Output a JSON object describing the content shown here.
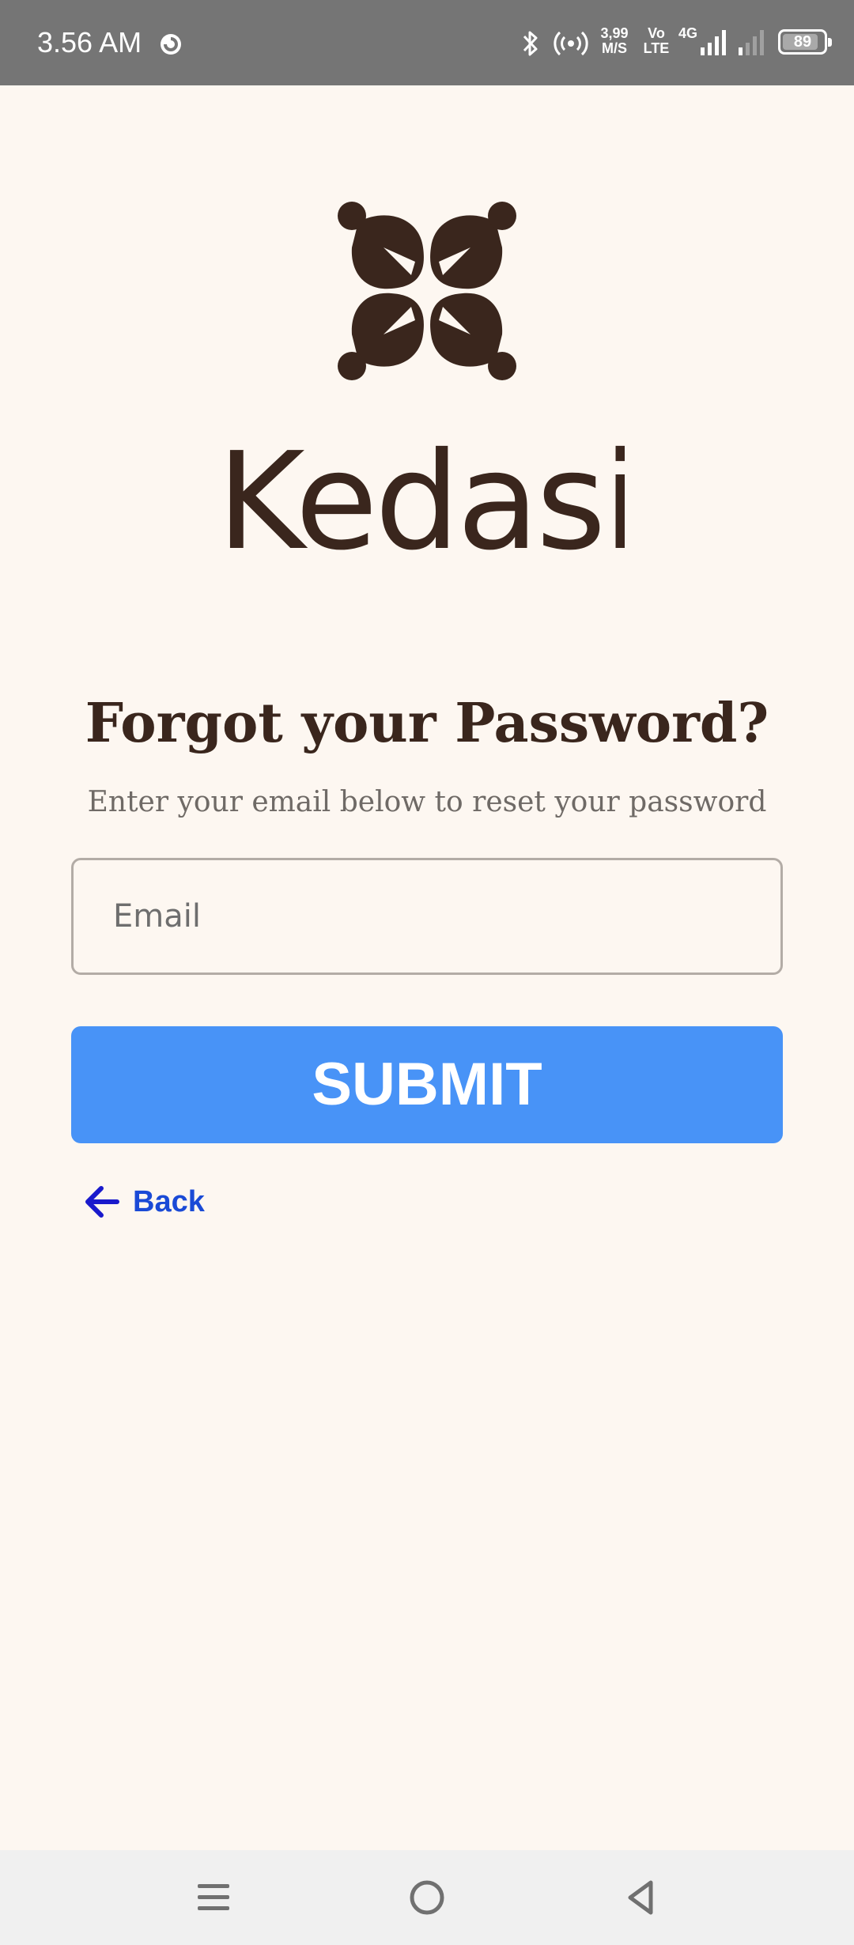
{
  "status_bar": {
    "time": "3.56 AM",
    "speed_value": "3,99",
    "speed_unit": "M/S",
    "volte_top": "Vo",
    "volte_bottom": "LTE",
    "network_type": "4G",
    "battery_percent": 89,
    "battery_text": "89",
    "icons": [
      "sync-icon",
      "bluetooth-icon",
      "hotspot-icon",
      "signal-icon",
      "signal-icon",
      "battery-icon"
    ]
  },
  "brand": {
    "name": "Kedasi",
    "logo_color": "#3a261d"
  },
  "form": {
    "title": "Forgot your Password?",
    "subtitle": "Enter your email below to reset your password",
    "email_placeholder": "Email",
    "email_value": "",
    "submit_label": "SUBMIT",
    "submit_color": "#4893f7",
    "back_label": "Back",
    "back_color": "#1a4ad6"
  },
  "nav_bar": {
    "icons": [
      "menu-icon",
      "home-icon",
      "back-triangle-icon"
    ]
  }
}
